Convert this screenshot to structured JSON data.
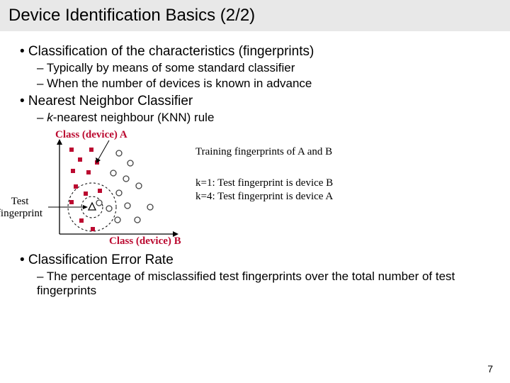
{
  "title": "Device Identification Basics (2/2)",
  "sections": {
    "s1": {
      "heading": "• Classification of the characteristics (fingerprints)",
      "sub1": "– Typically by means of some standard classifier",
      "sub2": "– When the number of devices is known in advance"
    },
    "s2": {
      "heading": "• Nearest Neighbor Classifier",
      "sub1_pre": "– ",
      "sub1_k": "k",
      "sub1_post": "-nearest neighbour (KNN) rule"
    },
    "s3": {
      "heading": "• Classification Error Rate",
      "sub1": "– The percentage of misclassified test fingerprints over the total number of test fingerprints"
    }
  },
  "diagram": {
    "class_a": "Class (device) A",
    "class_b": "Class (device) B",
    "test_label": "Test fingerprint",
    "training_label": "Training fingerprints of A and B",
    "kline1": "k=1: Test fingerprint is device B",
    "kline2": "k=4: Test fingerprint is device A"
  },
  "page_number": "7"
}
